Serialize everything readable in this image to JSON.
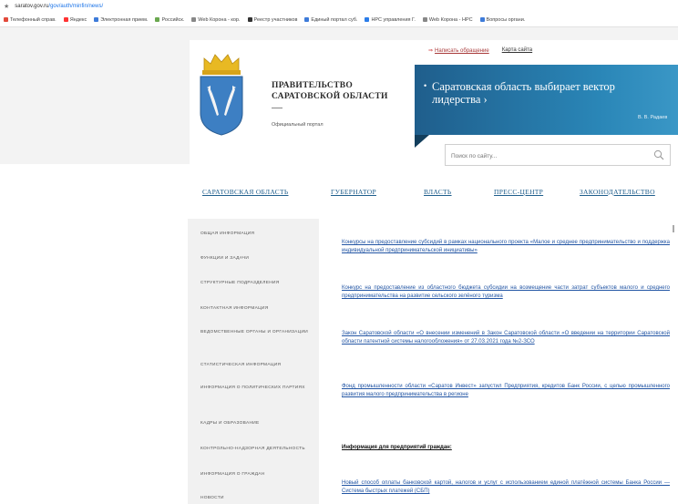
{
  "browser": {
    "url_host": "saratov.gov.ru",
    "url_path": "/gov/auth/minfin/news/",
    "bookmarks": [
      {
        "label": "Телефонный справ.",
        "color": "#e24a3b"
      },
      {
        "label": "Яндекс",
        "color": "#ff3333"
      },
      {
        "label": "Электронная прием.",
        "color": "#3d7bd9"
      },
      {
        "label": "Российск.",
        "color": "#6aa84f"
      },
      {
        "label": "Web Корона - кор.",
        "color": "#888888"
      },
      {
        "label": "Реестр участников",
        "color": "#333333"
      },
      {
        "label": "Единый портал суб.",
        "color": "#3d7bd9"
      },
      {
        "label": "НРС управления Г.",
        "color": "#2b7de9"
      },
      {
        "label": "Web Корона - НРС",
        "color": "#888888"
      },
      {
        "label": "Вопросы органи.",
        "color": "#3d7bd9"
      }
    ]
  },
  "header": {
    "title_line1": "ПРАВИТЕЛЬСТВО",
    "title_line2": "САРАТОВСКОЙ ОБЛАСТИ",
    "subtitle": "Официальный портал",
    "link_appeal": "Написать обращение",
    "link_sitemap": "Карта сайта",
    "banner_text": "Саратовская область выбирает вектор лидерства",
    "banner_arrow": "›",
    "banner_sign": "В. В. Радаев",
    "search_placeholder": "Поиск по сайту..."
  },
  "nav": {
    "items": [
      "САРАТОВСКАЯ ОБЛАСТЬ",
      "ГУБЕРНАТОР",
      "ВЛАСТЬ",
      "ПРЕСС-ЦЕНТР",
      "ЗАКОНОДАТЕЛЬСТВО"
    ]
  },
  "sidebar": {
    "items": [
      "ОБЩАЯ ИНФОРМАЦИЯ",
      "ФУНКЦИИ И ЗАДАЧИ",
      "СТРУКТУРНЫЕ ПОДРАЗДЕЛЕНИЯ",
      "КОНТАКТНАЯ ИНФОРМАЦИЯ",
      "ВЕДОМСТВЕННЫЕ ОРГАНЫ И ОРГАНИЗАЦИИ",
      "СТАТИСТИЧЕСКАЯ ИНФОРМАЦИЯ",
      "ИНФОРМАЦИЯ О ПОЛИТИЧЕСКИХ ПАРТИЯХ",
      "КАДРЫ И ОБРАЗОВАНИЕ",
      "КОНТРОЛЬНО-НАДЗОРНАЯ ДЕЯТЕЛЬНОСТЬ",
      "ИНФОРМАЦИЯ О ГРАЖДАН",
      "НОВОСТИ"
    ]
  },
  "content": {
    "news": [
      "Конкурсы на предоставление субсидий в рамках национального проекта «Малое и среднее предпринимательство и поддержка индивидуальной предпринимательской инициативы»",
      "Конкурс на предоставление из областного бюджета субсидии на возмещение части затрат субъектов малого и среднего предпринимательства на развитие сельского зелёного туризма",
      "Закон Саратовской области «О внесении изменений в Закон Саратовской области «О введении на территории Саратовской области патентной системы налогообложения» от 27.03.2021 года №2-ЗСО",
      "Фонд промышленности области «Саратов Инвест» запустил Предприятия, кредитов Банк России, с целью промышленного развития малого предпринимательства в регионе"
    ],
    "info_heading": "Информация для предприятий граждан:",
    "last_news": "Новый способ оплаты банковской картой, налогов и услуг с использованием единой платёжной системы Банка России — Система быстрых платежей (СБП)"
  }
}
